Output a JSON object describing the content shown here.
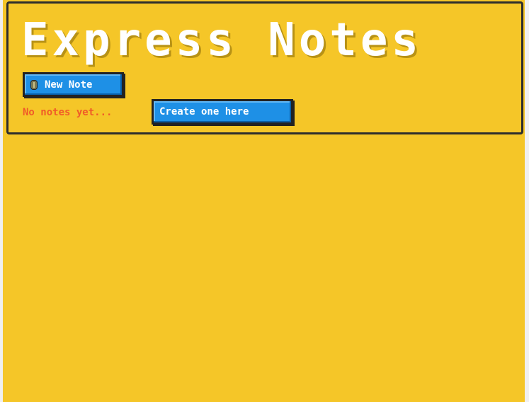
{
  "app": {
    "title": "Express Notes"
  },
  "header": {
    "new_note_label": "New Note",
    "new_note_icon": "note-icon"
  },
  "notes": {
    "empty_message": "No notes yet...",
    "create_label": "Create one here",
    "items": []
  },
  "colors": {
    "background": "#f5c628",
    "button": "#1e90e6",
    "empty_text": "#f05a28",
    "border": "#2d2d2d"
  }
}
